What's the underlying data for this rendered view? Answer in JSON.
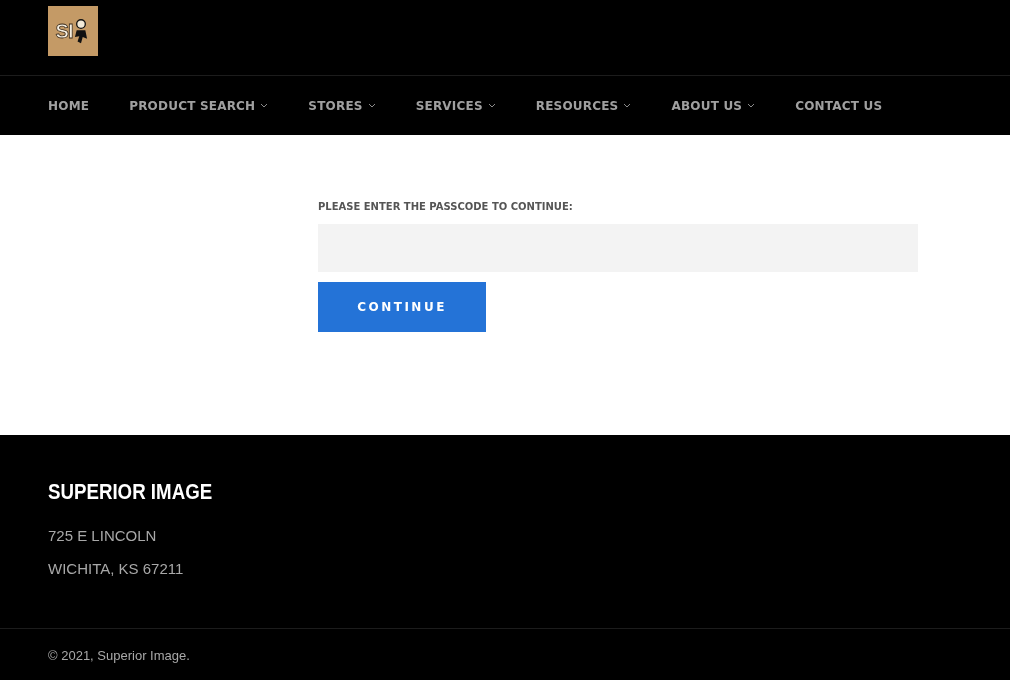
{
  "logo": {
    "text": "SI"
  },
  "nav": [
    {
      "label": "HOME",
      "has_dropdown": false
    },
    {
      "label": "PRODUCT SEARCH",
      "has_dropdown": true
    },
    {
      "label": "STORES",
      "has_dropdown": true
    },
    {
      "label": "SERVICES",
      "has_dropdown": true
    },
    {
      "label": "RESOURCES",
      "has_dropdown": true
    },
    {
      "label": "ABOUT US",
      "has_dropdown": true
    },
    {
      "label": "CONTACT US",
      "has_dropdown": false
    }
  ],
  "passcode_form": {
    "label": "PLEASE ENTER THE PASSCODE TO CONTINUE:",
    "button": "CONTINUE"
  },
  "footer": {
    "title": "SUPERIOR IMAGE",
    "address_lines": [
      "725 E LINCOLN",
      "WICHITA, KS 67211"
    ],
    "copyright": "© 2021, Superior Image."
  }
}
